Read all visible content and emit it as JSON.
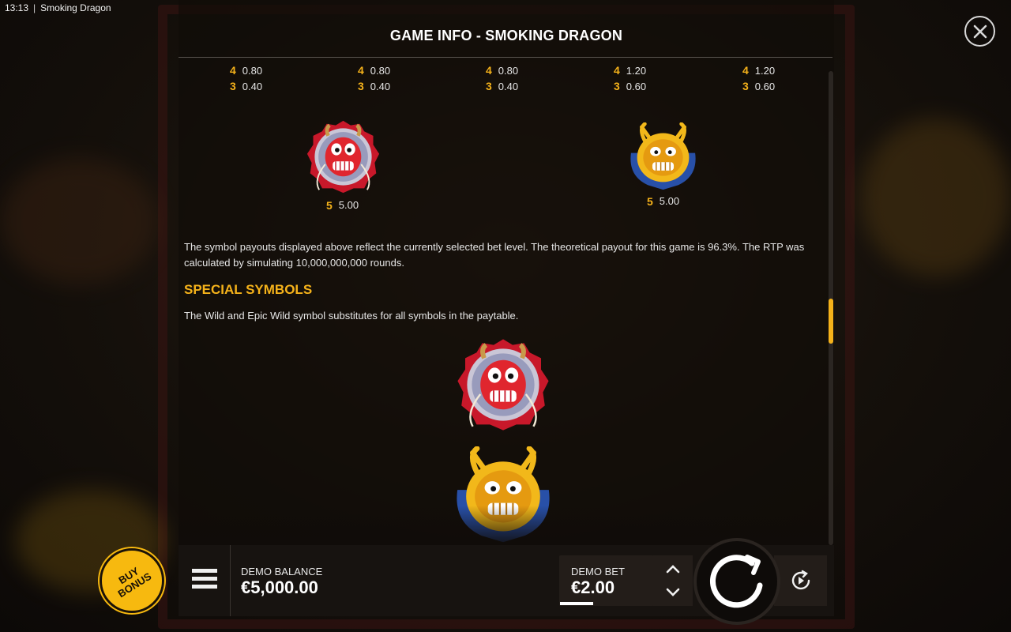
{
  "status_bar": {
    "time": "13:13",
    "separator": "|",
    "app_name": "Smoking Dragon"
  },
  "panel": {
    "title": "GAME INFO - SMOKING DRAGON"
  },
  "paytable_columns": [
    {
      "row4_count": "4",
      "row4_value": "0.80",
      "row3_count": "3",
      "row3_value": "0.40"
    },
    {
      "row4_count": "4",
      "row4_value": "0.80",
      "row3_count": "3",
      "row3_value": "0.40"
    },
    {
      "row4_count": "4",
      "row4_value": "0.80",
      "row3_count": "3",
      "row3_value": "0.40"
    },
    {
      "row4_count": "4",
      "row4_value": "1.20",
      "row3_count": "3",
      "row3_value": "0.60"
    },
    {
      "row4_count": "4",
      "row4_value": "1.20",
      "row3_count": "3",
      "row3_value": "0.60"
    }
  ],
  "dragon_symbols": [
    {
      "name": "red-dragon",
      "count": "5",
      "value": "5.00"
    },
    {
      "name": "gold-dragon",
      "count": "5",
      "value": "5.00"
    }
  ],
  "rtp_text": "The symbol payouts displayed above reflect the currently selected bet level. The theoretical payout for this game is 96.3%. The RTP was calculated by simulating 10,000,000,000 rounds.",
  "special_symbols": {
    "heading": "SPECIAL SYMBOLS",
    "description": "The Wild and Epic Wild symbol substitutes for all symbols in the paytable."
  },
  "bottom_bar": {
    "buy_bonus_label": "BUY BONUS",
    "balance_label": "DEMO BALANCE",
    "balance_value": "€5,000.00",
    "bet_label": "DEMO BET",
    "bet_value": "€2.00"
  },
  "colors": {
    "accent": "#f5b21a",
    "panel_bg": "#100c09",
    "text": "#e6e6e6",
    "red_dragon": "#d8242a",
    "gold_dragon": "#f2b81a"
  },
  "icons": [
    "close-icon",
    "menu-icon",
    "chevron-up-icon",
    "chevron-down-icon",
    "spin-icon",
    "autoplay-icon"
  ]
}
